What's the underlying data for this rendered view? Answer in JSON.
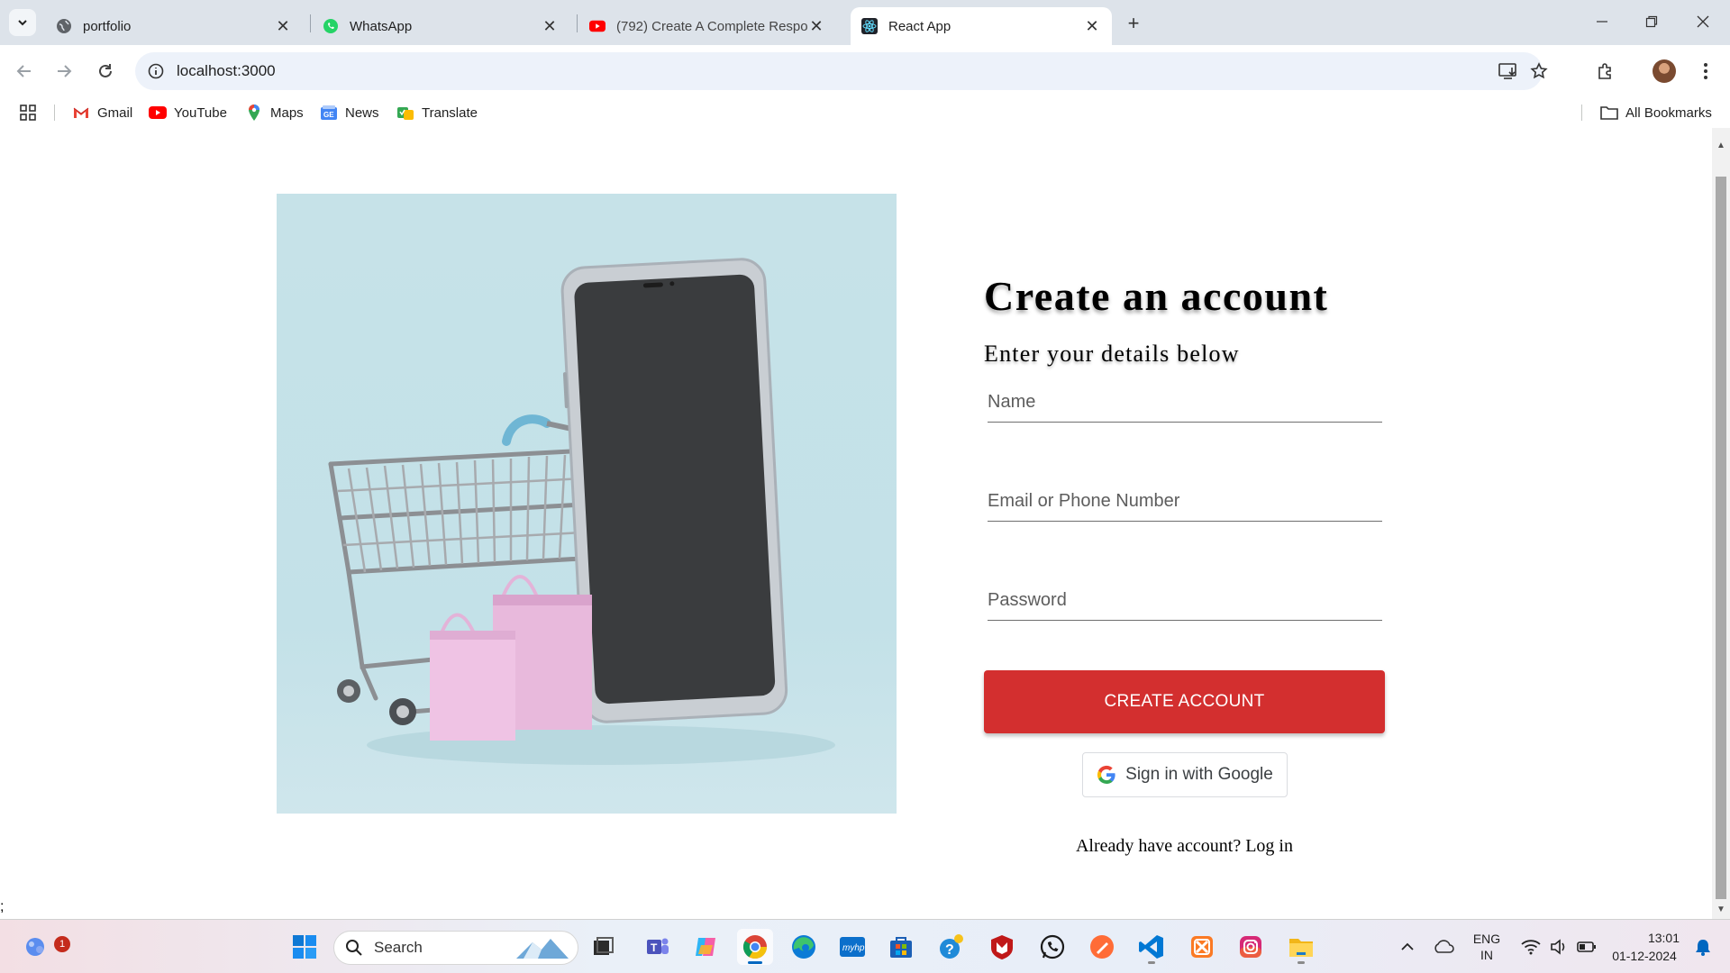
{
  "browser": {
    "tabs": [
      {
        "title": "portfolio",
        "active": false
      },
      {
        "title": "WhatsApp",
        "active": false
      },
      {
        "title": "(792) Create A Complete Respo",
        "active": false
      },
      {
        "title": "React App",
        "active": true
      }
    ],
    "url": "localhost:3000",
    "bookmarks": [
      "Gmail",
      "YouTube",
      "Maps",
      "News",
      "Translate"
    ],
    "all_bookmarks_label": "All Bookmarks"
  },
  "page": {
    "title": "Create an account",
    "subtitle": "Enter your details below",
    "fields": {
      "name_placeholder": "Name",
      "email_placeholder": "Email or Phone Number",
      "password_placeholder": "Password"
    },
    "create_button": "CREATE ACCOUNT",
    "google_button": "Sign in with Google",
    "login_prompt": "Already have account?",
    "login_link": "Log in",
    "stray_text": ";"
  },
  "taskbar": {
    "search_label": "Search",
    "notification_count": "1",
    "language_top": "ENG",
    "language_bottom": "IN",
    "time": "13:01",
    "date": "01-12-2024"
  },
  "colors": {
    "accent_red": "#d32f2f",
    "tab_strip": "#dde3ea",
    "omnibox": "#edf2fa",
    "image_bg": "#c6e2e8"
  }
}
